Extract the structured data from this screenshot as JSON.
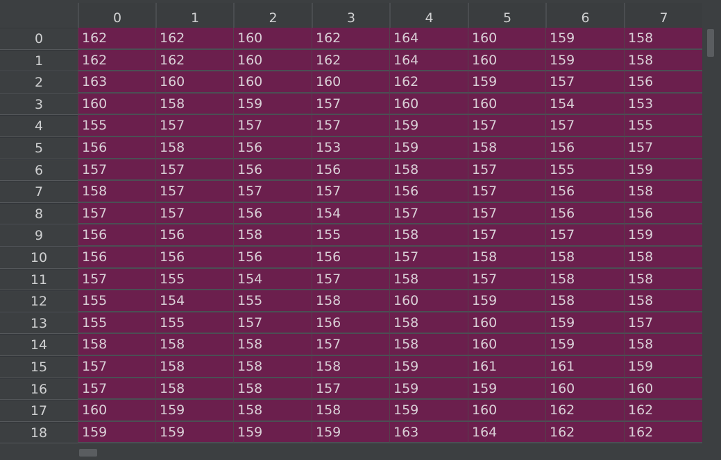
{
  "table": {
    "columns": [
      "0",
      "1",
      "2",
      "3",
      "4",
      "5",
      "6",
      "7"
    ],
    "row_labels": [
      "0",
      "1",
      "2",
      "3",
      "4",
      "5",
      "6",
      "7",
      "8",
      "9",
      "10",
      "11",
      "12",
      "13",
      "14",
      "15",
      "16",
      "17",
      "18"
    ],
    "rows": [
      [
        "162",
        "162",
        "160",
        "162",
        "164",
        "160",
        "159",
        "158"
      ],
      [
        "162",
        "162",
        "160",
        "162",
        "164",
        "160",
        "159",
        "158"
      ],
      [
        "163",
        "160",
        "160",
        "160",
        "162",
        "159",
        "157",
        "156"
      ],
      [
        "160",
        "158",
        "159",
        "157",
        "160",
        "160",
        "154",
        "153"
      ],
      [
        "155",
        "157",
        "157",
        "157",
        "159",
        "157",
        "157",
        "155"
      ],
      [
        "156",
        "158",
        "156",
        "153",
        "159",
        "158",
        "156",
        "157"
      ],
      [
        "157",
        "157",
        "156",
        "156",
        "158",
        "157",
        "155",
        "159"
      ],
      [
        "158",
        "157",
        "157",
        "157",
        "156",
        "157",
        "156",
        "158"
      ],
      [
        "157",
        "157",
        "156",
        "154",
        "157",
        "157",
        "156",
        "156"
      ],
      [
        "156",
        "156",
        "158",
        "155",
        "158",
        "157",
        "157",
        "159"
      ],
      [
        "156",
        "156",
        "156",
        "156",
        "157",
        "158",
        "158",
        "158"
      ],
      [
        "157",
        "155",
        "154",
        "157",
        "158",
        "157",
        "158",
        "158"
      ],
      [
        "155",
        "154",
        "155",
        "158",
        "160",
        "159",
        "158",
        "158"
      ],
      [
        "155",
        "155",
        "157",
        "156",
        "158",
        "160",
        "159",
        "157"
      ],
      [
        "158",
        "158",
        "158",
        "157",
        "158",
        "160",
        "159",
        "158"
      ],
      [
        "157",
        "158",
        "158",
        "158",
        "159",
        "161",
        "161",
        "159"
      ],
      [
        "157",
        "158",
        "158",
        "157",
        "159",
        "159",
        "160",
        "160"
      ],
      [
        "160",
        "159",
        "158",
        "158",
        "159",
        "160",
        "162",
        "162"
      ],
      [
        "159",
        "159",
        "159",
        "159",
        "163",
        "164",
        "162",
        "162"
      ]
    ]
  },
  "colors": {
    "background": "#3c3f41",
    "cell_fill": "#6b1f4d",
    "text": "#cfd0d1"
  }
}
